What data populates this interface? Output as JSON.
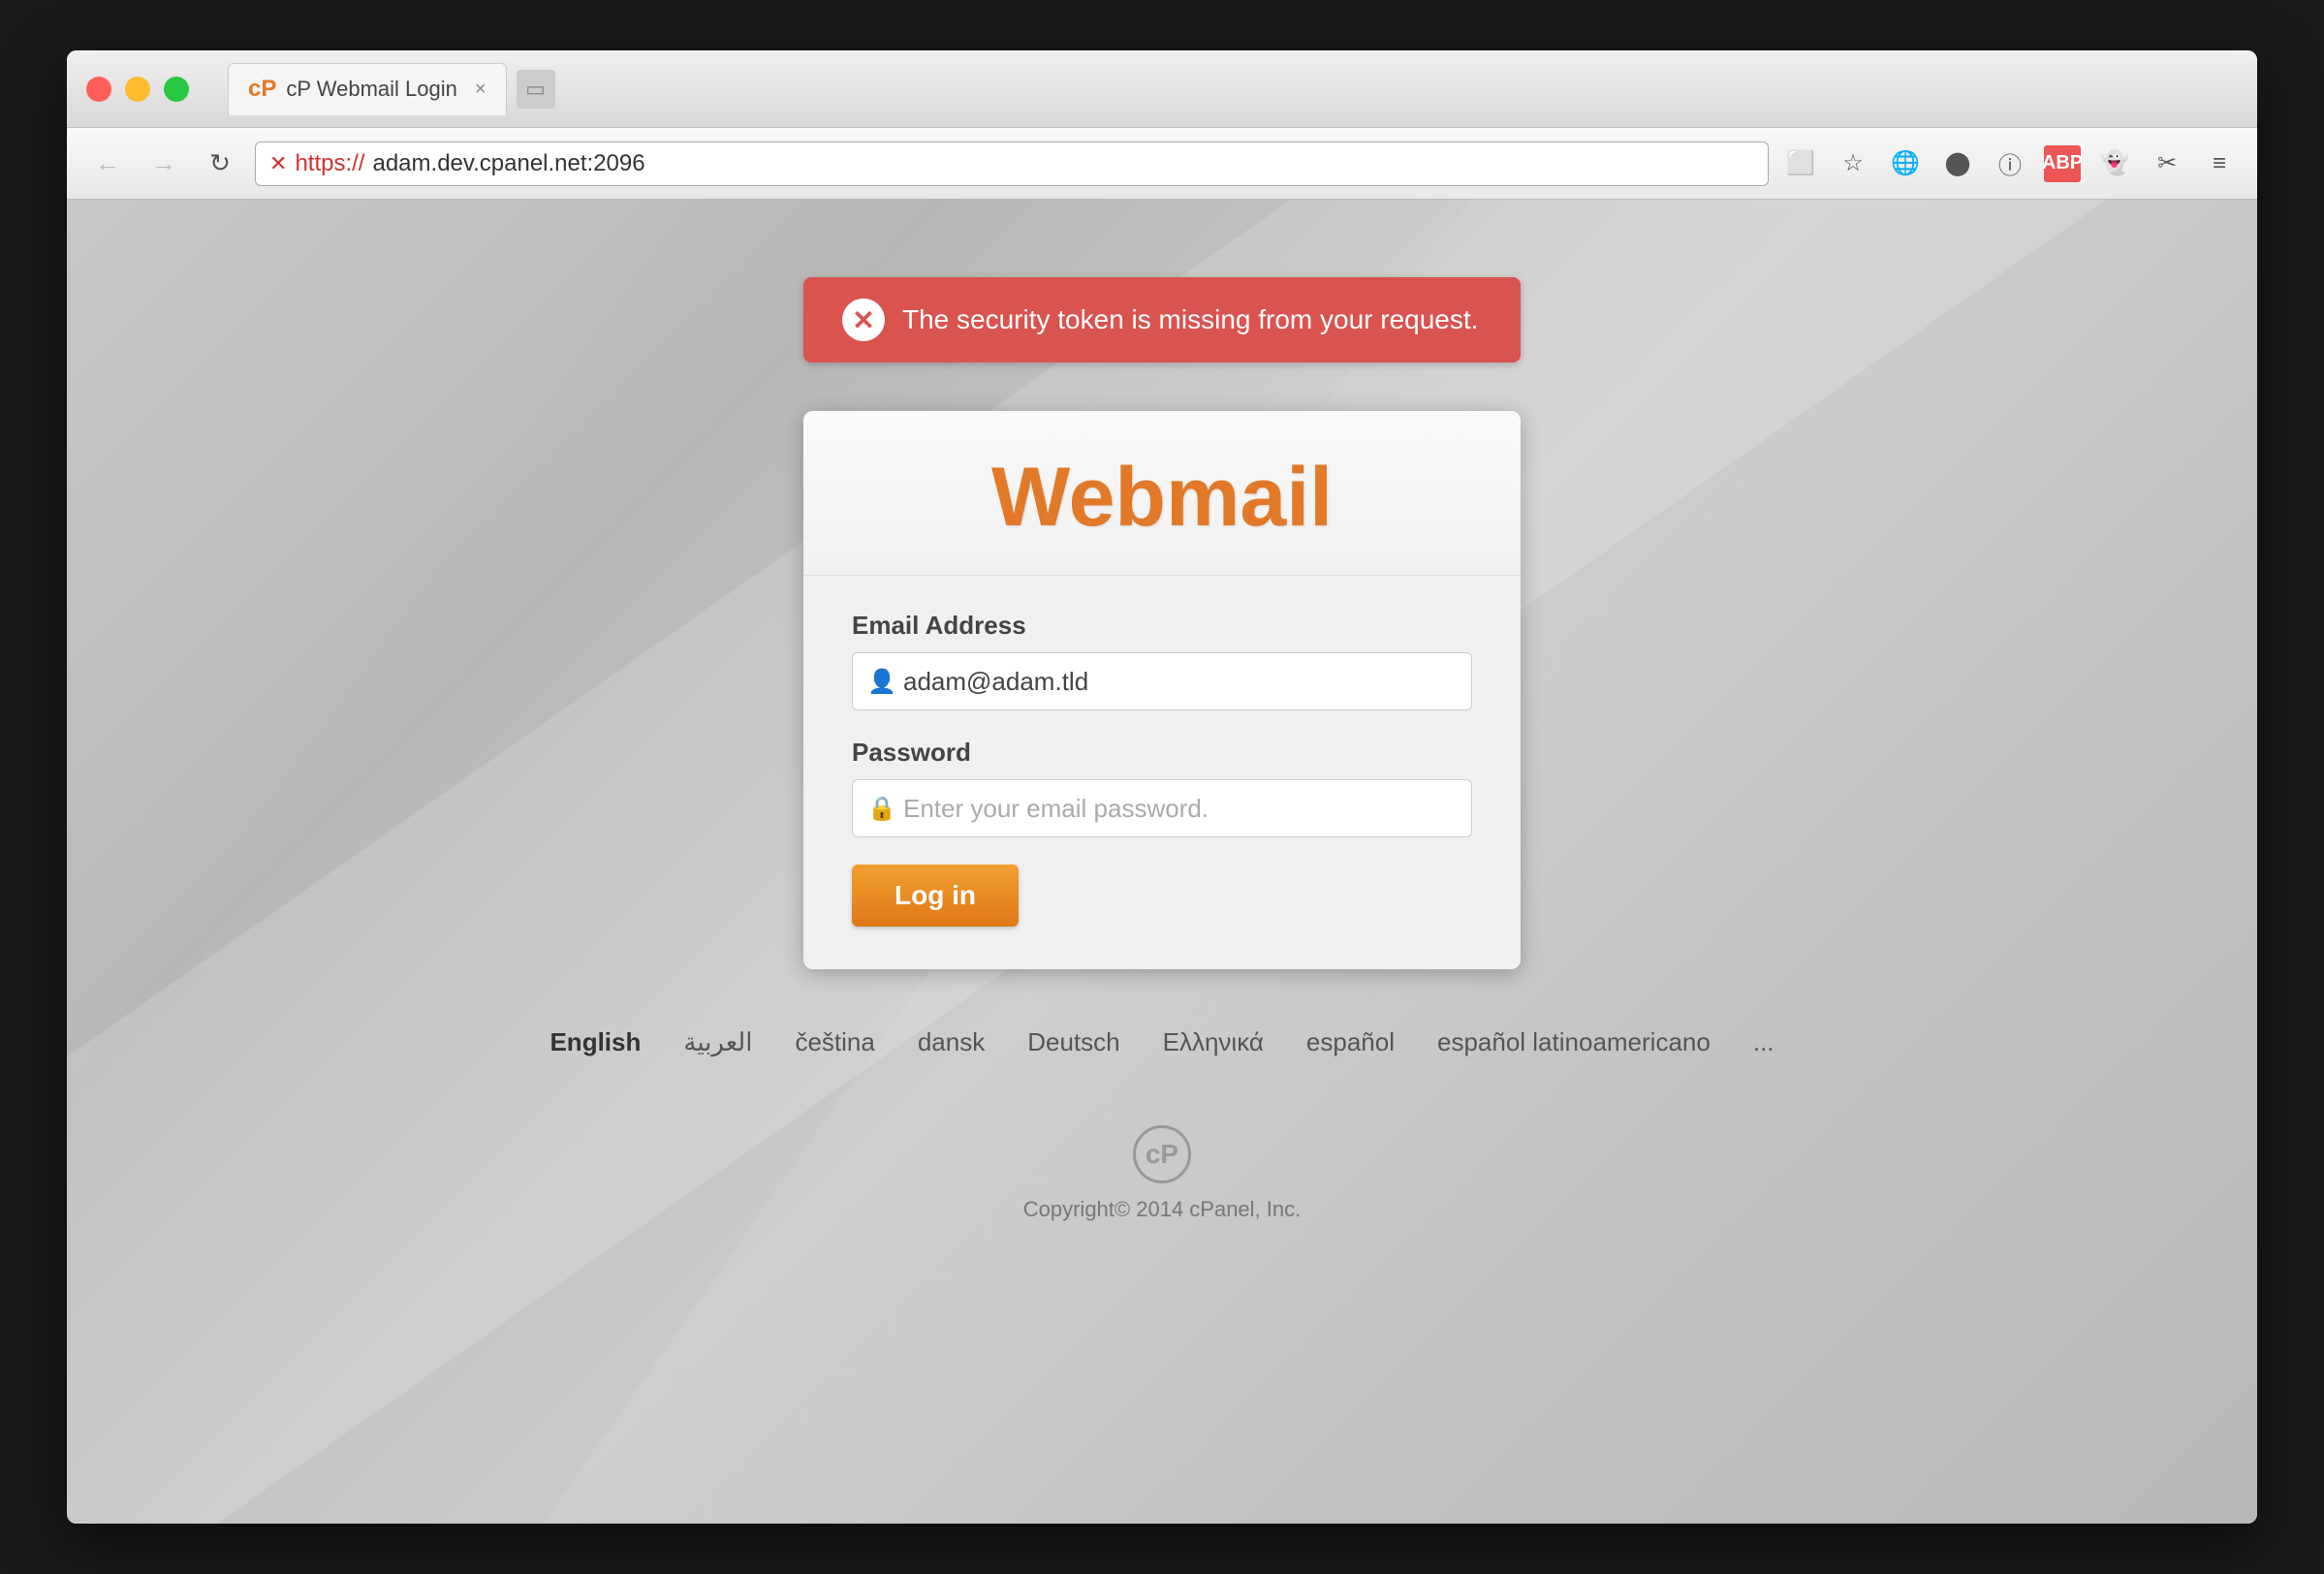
{
  "browser": {
    "title": "cP Webmail Login",
    "url_protocol": "https://",
    "url_domain": "adam.dev.cpanel.net:2096",
    "url_full": "https://adam.dev.cpanel.net:2096"
  },
  "error": {
    "message": "The security token is missing from your request."
  },
  "login": {
    "title": "Webmail",
    "email_label": "Email Address",
    "email_value": "adam@adam.tld",
    "password_label": "Password",
    "password_placeholder": "Enter your email password.",
    "login_button": "Log in"
  },
  "languages": {
    "items": [
      {
        "label": "English",
        "active": true
      },
      {
        "label": "العربية",
        "active": false
      },
      {
        "label": "čeština",
        "active": false
      },
      {
        "label": "dansk",
        "active": false
      },
      {
        "label": "Deutsch",
        "active": false
      },
      {
        "label": "Ελληνικά",
        "active": false
      },
      {
        "label": "español",
        "active": false
      },
      {
        "label": "español latinoamericano",
        "active": false
      },
      {
        "label": "...",
        "active": false
      }
    ]
  },
  "footer": {
    "copyright": "Copyright© 2014 cPanel, Inc.",
    "logo_text": "cP"
  }
}
